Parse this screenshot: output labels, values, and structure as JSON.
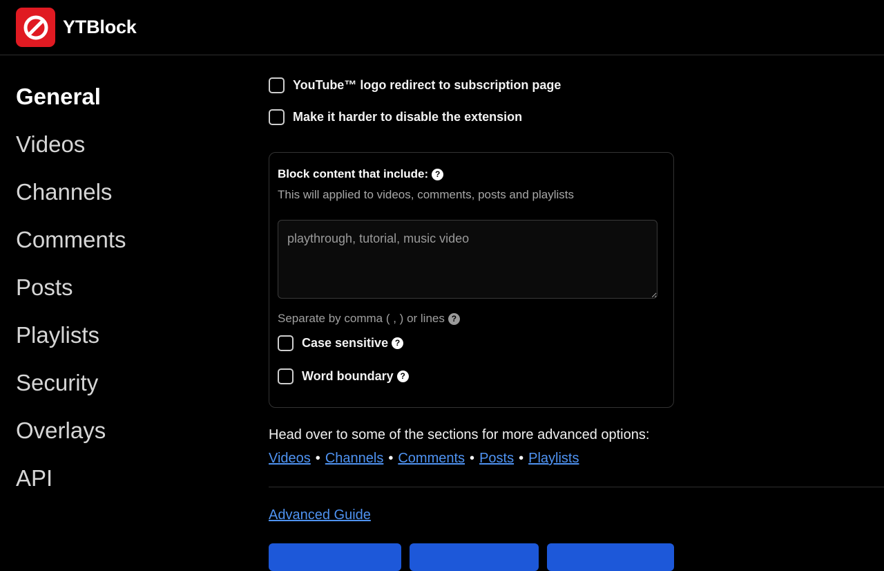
{
  "app": {
    "title": "YTBlock",
    "logo_icon": "block-icon",
    "accent": "#e01a22"
  },
  "sidebar": {
    "items": [
      {
        "label": "General",
        "active": true
      },
      {
        "label": "Videos",
        "active": false
      },
      {
        "label": "Channels",
        "active": false
      },
      {
        "label": "Comments",
        "active": false
      },
      {
        "label": "Posts",
        "active": false
      },
      {
        "label": "Playlists",
        "active": false
      },
      {
        "label": "Security",
        "active": false
      },
      {
        "label": "Overlays",
        "active": false
      },
      {
        "label": "API",
        "active": false
      }
    ]
  },
  "options": {
    "logo_redirect": {
      "label": "YouTube™ logo redirect to subscription page",
      "checked": false
    },
    "harder_disable": {
      "label": "Make it harder to disable the extension",
      "checked": false
    }
  },
  "block_card": {
    "title": "Block content that include:",
    "subtitle": "This will applied to videos, comments, posts and playlists",
    "placeholder": "playthrough, tutorial, music video",
    "value": "",
    "hint": "Separate by comma ( , ) or lines",
    "case_sensitive": {
      "label": "Case sensitive",
      "checked": false
    },
    "word_boundary": {
      "label": "Word boundary",
      "checked": false
    }
  },
  "advanced": {
    "text": "Head over to some of the sections for more advanced options:",
    "links": [
      "Videos",
      "Channels",
      "Comments",
      "Posts",
      "Playlists"
    ],
    "separator": "•",
    "guide": "Advanced Guide"
  },
  "colors": {
    "link": "#4f93f2",
    "button": "#1d58d9"
  }
}
